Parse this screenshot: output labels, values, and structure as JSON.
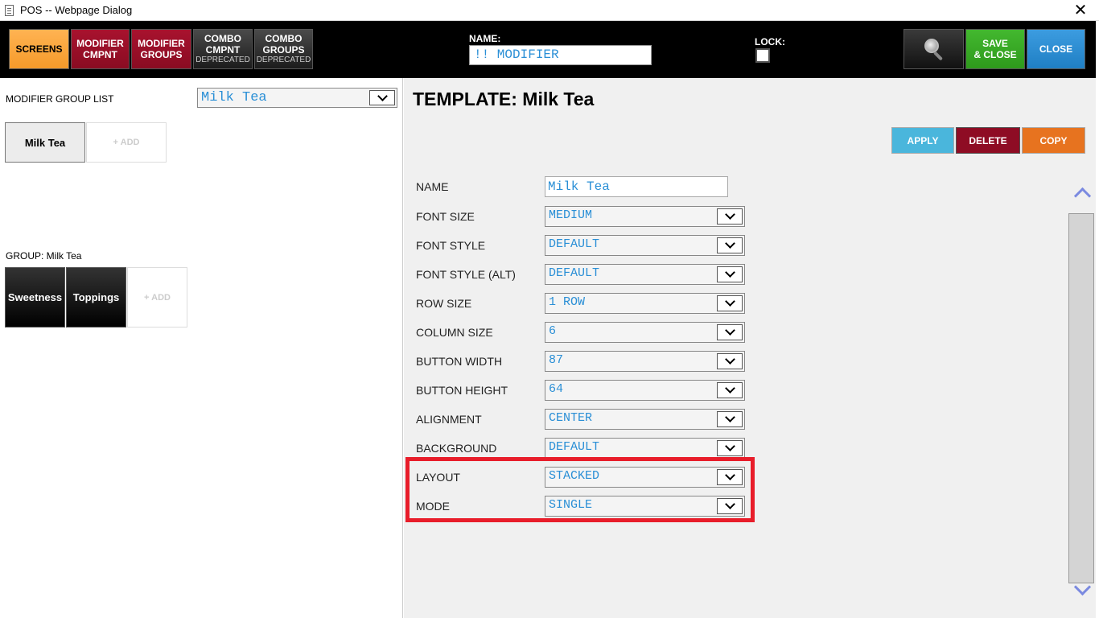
{
  "window": {
    "title": "POS -- Webpage Dialog",
    "close_glyph": "✕"
  },
  "toolbar": {
    "screens": "SCREENS",
    "modifier_cmpnt": [
      "MODIFIER",
      "CMPNT"
    ],
    "modifier_groups": [
      "MODIFIER",
      "GROUPS"
    ],
    "combo_cmpnt": {
      "line1": "COMBO",
      "line2": "CMPNT",
      "sub": "DEPRECATED"
    },
    "combo_groups": {
      "line1": "COMBO",
      "line2": "GROUPS",
      "sub": "DEPRECATED"
    },
    "name_label": "NAME:",
    "name_value": "!! MODIFIER",
    "lock_label": "LOCK:",
    "lock_checked": false,
    "save_close": [
      "SAVE",
      "& CLOSE"
    ],
    "close": "CLOSE",
    "search_icon": "magnifier-icon"
  },
  "left": {
    "group_list_label": "MODIFIER GROUP LIST",
    "group_list_value": "Milk Tea",
    "template_tiles": [
      {
        "label": "Milk Tea",
        "selected": true
      },
      {
        "label": "+ ADD",
        "selected": false
      }
    ],
    "group_label": "GROUP: Milk Tea",
    "group_tiles": [
      {
        "label": "Sweetness"
      },
      {
        "label": "Toppings"
      },
      {
        "label": "+ ADD"
      }
    ]
  },
  "right": {
    "template_title": "TEMPLATE: Milk Tea",
    "actions": {
      "apply": "APPLY",
      "delete": "DELETE",
      "copy": "COPY"
    },
    "fields": [
      {
        "label": "NAME",
        "value": "Milk Tea",
        "type": "text"
      },
      {
        "label": "FONT SIZE",
        "value": "MEDIUM",
        "type": "select"
      },
      {
        "label": "FONT STYLE",
        "value": "DEFAULT",
        "type": "select"
      },
      {
        "label": "FONT STYLE (ALT)",
        "value": "DEFAULT",
        "type": "select"
      },
      {
        "label": "ROW SIZE",
        "value": "1 ROW",
        "type": "select"
      },
      {
        "label": "COLUMN SIZE",
        "value": "6",
        "type": "select"
      },
      {
        "label": "BUTTON WIDTH",
        "value": "87",
        "type": "select"
      },
      {
        "label": "BUTTON HEIGHT",
        "value": "64",
        "type": "select"
      },
      {
        "label": "ALIGNMENT",
        "value": "CENTER",
        "type": "select"
      },
      {
        "label": "BACKGROUND",
        "value": "DEFAULT",
        "type": "select"
      },
      {
        "label": "LAYOUT",
        "value": "STACKED",
        "type": "select"
      },
      {
        "label": "MODE",
        "value": "SINGLE",
        "type": "select"
      }
    ],
    "highlight_color": "#e81d2a"
  },
  "colors": {
    "screens": "#f59a2a",
    "modifier": "#8a0c22",
    "save": "#2e9a1c",
    "close": "#1f7fc4",
    "apply": "#4ab6dc",
    "copy": "#e7731f",
    "value_text": "#2a8fd6"
  }
}
